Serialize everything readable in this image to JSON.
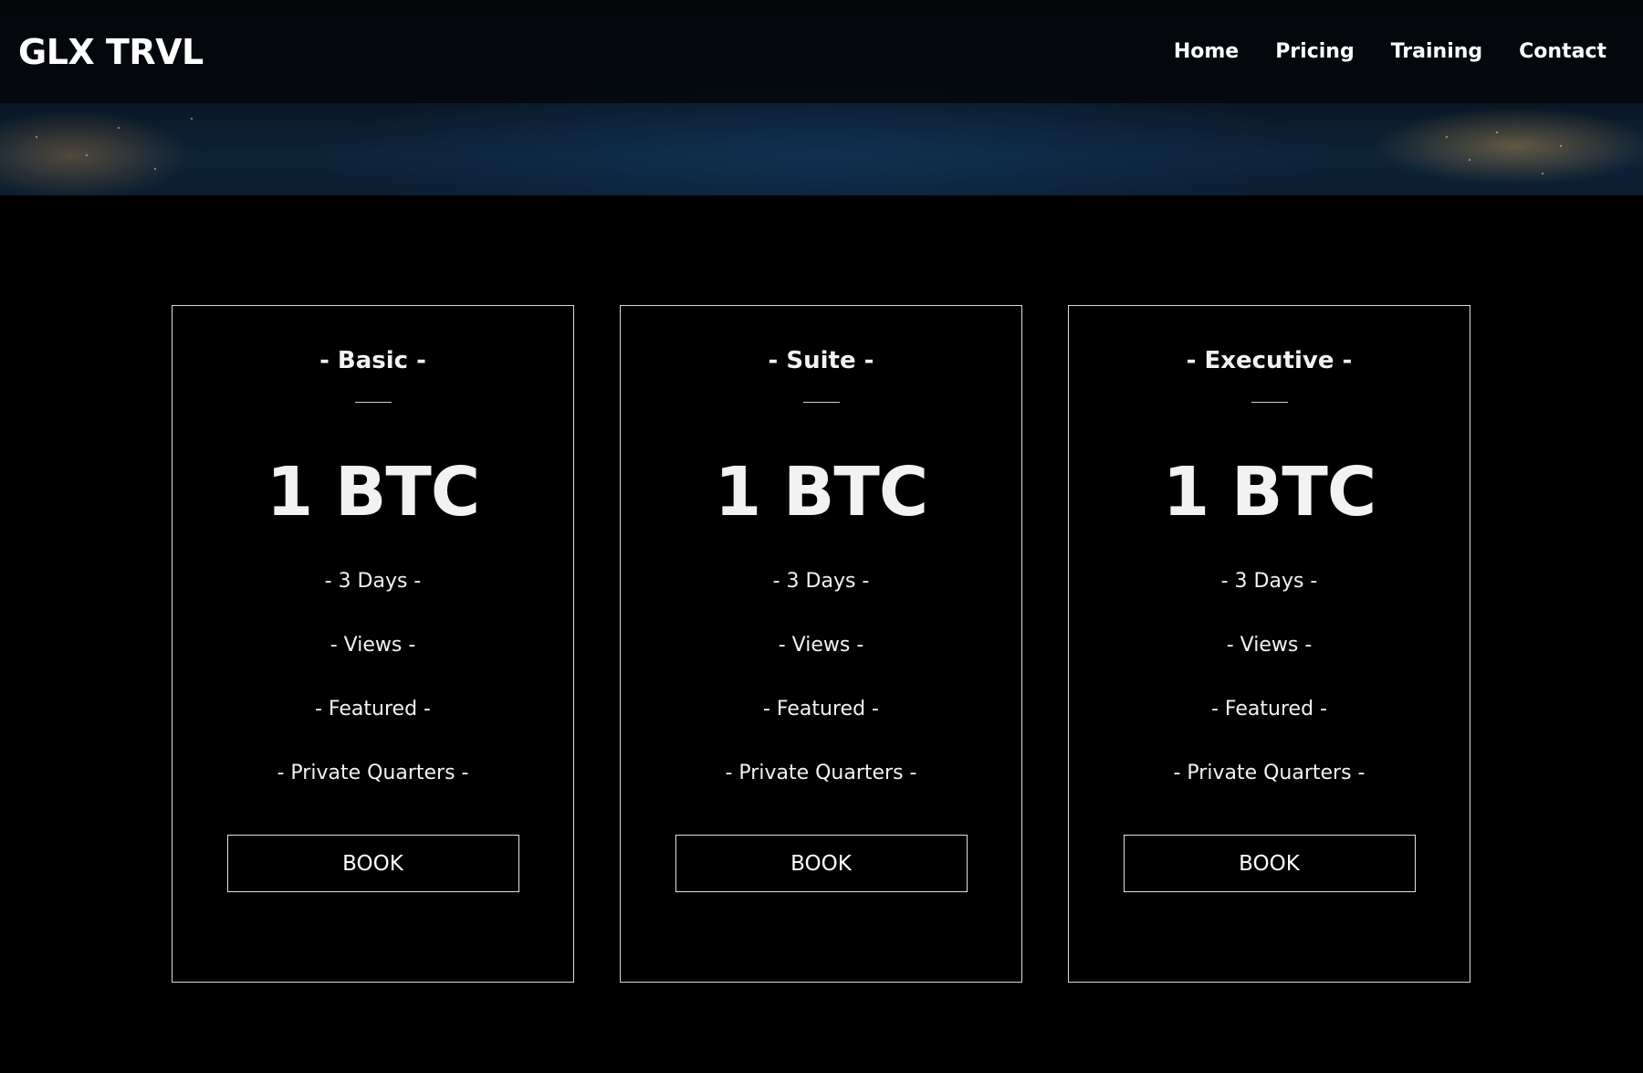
{
  "site": {
    "logo": "GLX TRVL"
  },
  "nav": {
    "items": [
      "Home",
      "Pricing",
      "Training",
      "Contact"
    ]
  },
  "plans": [
    {
      "title": "- Basic -",
      "price": "1 BTC",
      "features": [
        "- 3 Days -",
        "- Views -",
        "- Featured -",
        "- Private Quarters -"
      ],
      "button": "BOOK"
    },
    {
      "title": "- Suite -",
      "price": "1 BTC",
      "features": [
        "- 3 Days -",
        "- Views -",
        "- Featured -",
        "- Private Quarters -"
      ],
      "button": "BOOK"
    },
    {
      "title": "- Executive -",
      "price": "1 BTC",
      "features": [
        "- 3 Days -",
        "- Views -",
        "- Featured -",
        "- Private Quarters -"
      ],
      "button": "BOOK"
    }
  ]
}
